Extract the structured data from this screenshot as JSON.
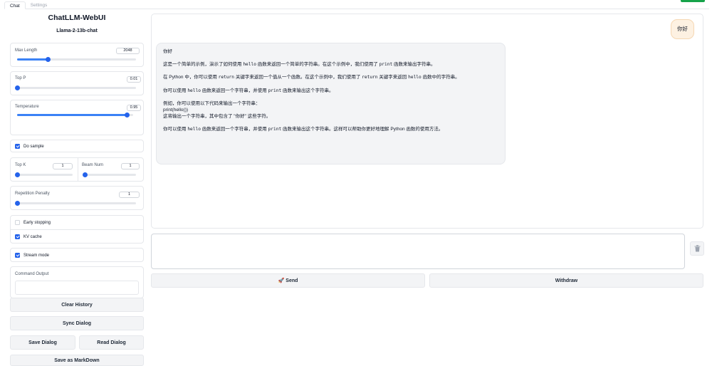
{
  "tabs": [
    {
      "label": "Chat",
      "active": true
    },
    {
      "label": "Settings",
      "active": false
    }
  ],
  "app": {
    "title": "ChatLLM-WebUI",
    "model": "Llama-2-13b-chat"
  },
  "params": {
    "max_length": {
      "label": "Max Length",
      "value": "2048",
      "fraction": 0.26
    },
    "top_p": {
      "label": "Top P",
      "value": "0.01",
      "fraction": 0.0
    },
    "temperature": {
      "label": "Temperature",
      "value": "0.95",
      "fraction": 0.95
    },
    "do_sample": {
      "label": "Do sample",
      "checked": true
    },
    "top_k": {
      "label": "Top K",
      "value": "1",
      "fraction": 0.0
    },
    "beam_num": {
      "label": "Beam Num",
      "value": "1",
      "fraction": 0.0
    },
    "repetition_penalty": {
      "label": "Repetition Penalty",
      "value": "1",
      "fraction": 0.0
    },
    "early_stopping": {
      "label": "Early stopping",
      "checked": false
    },
    "kv_cache": {
      "label": "KV cache",
      "checked": true
    },
    "stream_mode": {
      "label": "Stream mode",
      "checked": true
    },
    "command_output": {
      "label": "Command Output",
      "value": ""
    }
  },
  "buttons": {
    "clear_history": "Clear History",
    "sync_dialog": "Sync Dialog",
    "save_dialog": "Save Dialog",
    "read_dialog": "Read Dialog",
    "save_markdown": "Save as MarkDown",
    "send": "🚀 Send",
    "withdraw": "Withdraw"
  },
  "chat": {
    "user_message": "你好",
    "bot": {
      "greeting": "你好",
      "p1": {
        "a": "这是一个简单的示例，演示了如何使用 ",
        "code1": "hello",
        "b": " 函数来返回一个简单的字符串。在这个示例中，我们使用了 ",
        "code2": "print",
        "c": " 函数来输出字符串。"
      },
      "p2": {
        "a": "在 Python 中，你可以使用 ",
        "code1": "return",
        "b": " 关键字来返回一个值从一个函数。在这个示例中，我们使用了 ",
        "code2": "return",
        "c": " 关键字来返回 ",
        "code3": "hello",
        "d": " 函数中的字符串。"
      },
      "p3": {
        "a": "你可以使用 ",
        "code1": "hello",
        "b": " 函数来返回一个字符串，并使用 ",
        "code2": "print",
        "c": " 函数来输出这个字符串。"
      },
      "p4": {
        "line1": "例如，你可以使用以下代码来输出一个字符串：",
        "line2": "print(hello())",
        "line3": "这将输出一个字符串，其中包含了 \"你好\" 这些字符。"
      },
      "p5": {
        "a": "你可以使用 ",
        "code1": "hello",
        "b": " 函数来返回一个字符串，并使用 ",
        "code2": "print",
        "c": " 函数来输出这个字符串。这样可以帮助你更好地理解 Python 函数的使用方法。"
      }
    }
  },
  "input": {
    "placeholder": ""
  },
  "icons": {
    "trash": "trash-icon"
  },
  "colors": {
    "accent": "#2563eb",
    "user_bubble": "#fdf1e2"
  }
}
